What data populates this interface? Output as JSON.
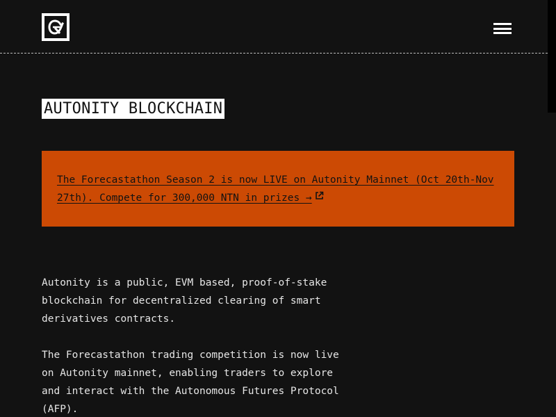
{
  "header": {
    "logo_icon": "autonity-logo-icon",
    "menu_icon": "hamburger-menu-icon"
  },
  "page": {
    "title": "AUTONITY BLOCKCHAIN"
  },
  "banner": {
    "text": "The Forecastathon Season 2 is now LIVE on Autonity Mainnet (Oct 20th-Nov 27th). Compete for 300,000 NTN in prizes →",
    "icon": "external-link-icon",
    "background": "#cc4a04"
  },
  "main": {
    "paragraphs": [
      "Autonity is a public, EVM based, proof-of-stake blockchain for decentralized clearing of smart derivatives contracts.",
      "The Forecastathon trading competition is now live on Autonity mainnet, enabling traders to explore and interact with the Autonomous Futures Protocol (AFP)."
    ]
  }
}
